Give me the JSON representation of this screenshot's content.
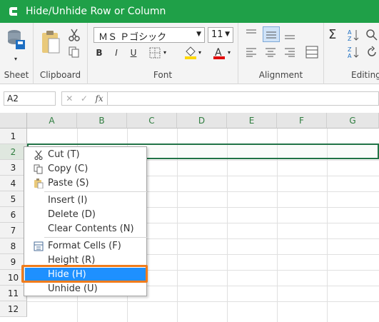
{
  "window": {
    "title": "Hide/Unhide Row or Column"
  },
  "ribbon": {
    "groups": {
      "sheet": "Sheet",
      "clipboard": "Clipboard",
      "font": "Font",
      "alignment": "Alignment",
      "editing": "Editing"
    },
    "font_name": "ＭＳ Ｐゴシック",
    "font_size": "11",
    "bold": "B",
    "italic": "I",
    "underline": "U"
  },
  "formula_bar": {
    "name_box": "A2",
    "fx_label": "fx",
    "formula": ""
  },
  "grid": {
    "columns": [
      "A",
      "B",
      "C",
      "D",
      "E",
      "F",
      "G"
    ],
    "rows": [
      "1",
      "2",
      "3",
      "4",
      "5",
      "6",
      "7",
      "8",
      "9",
      "10",
      "11",
      "12"
    ],
    "selected_row": "2"
  },
  "context_menu": {
    "items": [
      {
        "label": "Cut (T)",
        "icon": "scissors-icon"
      },
      {
        "label": "Copy (C)",
        "icon": "copy-icon"
      },
      {
        "label": "Paste (S)",
        "icon": "paste-icon"
      },
      {
        "label": "Insert (I)"
      },
      {
        "label": "Delete (D)"
      },
      {
        "label": "Clear Contents (N)"
      },
      {
        "label": "Format Cells (F)",
        "icon": "format-cells-icon"
      },
      {
        "label": "Height (R)"
      },
      {
        "label": "Hide (H)",
        "highlighted": true
      },
      {
        "label": "Unhide (U)"
      }
    ]
  },
  "colors": {
    "title_bar": "#1fa048",
    "highlight": "#1e90ff",
    "callout": "#f07c1c",
    "selection": "#217346"
  }
}
